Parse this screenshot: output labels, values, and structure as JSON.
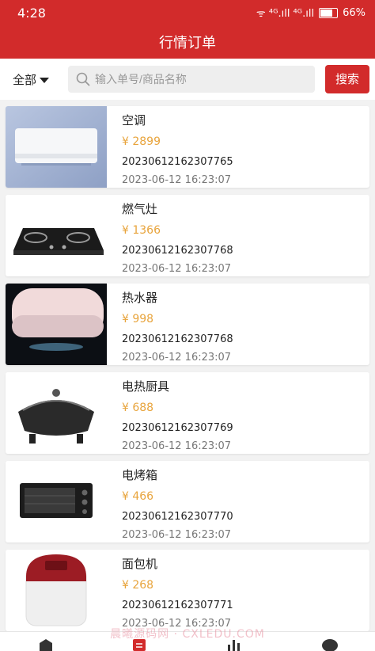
{
  "status_bar": {
    "time": "4:28",
    "network": "ᯤ ⁴ᴳ.ıll ⁴ᴳ.ıll",
    "battery": "66%"
  },
  "header": {
    "title": "行情订单"
  },
  "filter": {
    "selected": "全部",
    "search_placeholder": "输入单号/商品名称",
    "search_button": "搜索"
  },
  "orders": [
    {
      "name": "空调",
      "price": "¥  2899",
      "order_no": "20230612162307765",
      "date": "2023-06-12 16:23:07"
    },
    {
      "name": "燃气灶",
      "price": "¥  1366",
      "order_no": "20230612162307768",
      "date": "2023-06-12 16:23:07"
    },
    {
      "name": "热水器",
      "price": "¥  998",
      "order_no": "20230612162307768",
      "date": "2023-06-12 16:23:07"
    },
    {
      "name": "电热厨具",
      "price": "¥  688",
      "order_no": "20230612162307769",
      "date": "2023-06-12 16:23:07"
    },
    {
      "name": "电烤箱",
      "price": "¥  466",
      "order_no": "20230612162307770",
      "date": "2023-06-12 16:23:07"
    },
    {
      "name": "面包机",
      "price": "¥  268",
      "order_no": "20230612162307771",
      "date": "2023-06-12 16:23:07"
    }
  ],
  "watermark": "晨曦源码网 · CXLEDU.COM",
  "colors": {
    "brand_red": "#d22b2b",
    "price_orange": "#e8a43c"
  }
}
